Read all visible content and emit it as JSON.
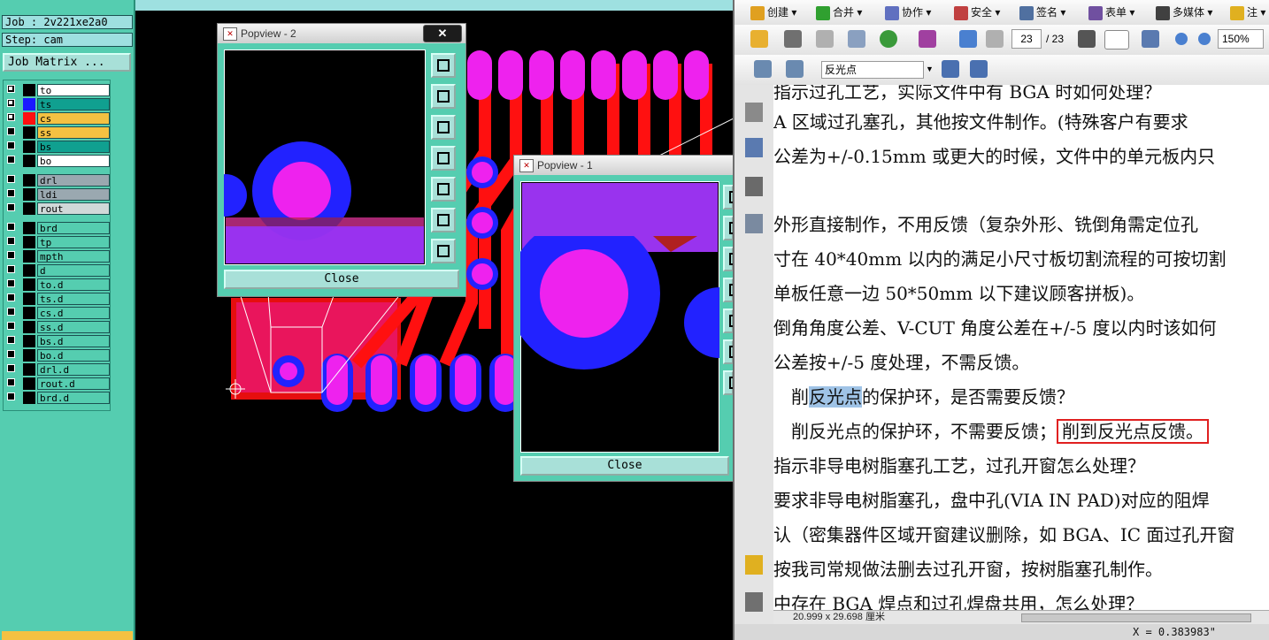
{
  "cam": {
    "job_line": "Job : 2v221xe2a0",
    "step_line": "Step: cam",
    "job_matrix_label": "Job Matrix ...",
    "layers": [
      {
        "name": "to",
        "checked": true,
        "swatch": "#000000",
        "bg": "#ffffff"
      },
      {
        "name": "ts",
        "checked": true,
        "swatch": "#1a1aff",
        "bg": "#10a090"
      },
      {
        "name": "cs",
        "checked": true,
        "swatch": "#ff1010",
        "bg": "#f4c142"
      },
      {
        "name": "ss",
        "checked": false,
        "swatch": "#000000",
        "bg": "#f4c142"
      },
      {
        "name": "bs",
        "checked": false,
        "swatch": "#000000",
        "bg": "#10a090"
      },
      {
        "name": "bo",
        "checked": false,
        "swatch": "#000000",
        "bg": "#ffffff"
      },
      {
        "name": "drl",
        "checked": false,
        "swatch": "#000000",
        "bg": "#9aa8b0"
      },
      {
        "name": "ldi",
        "checked": false,
        "swatch": "#000000",
        "bg": "#9aa8b0"
      },
      {
        "name": "rout",
        "checked": false,
        "swatch": "#000000",
        "bg": "#d0d8d8"
      },
      {
        "name": "brd",
        "checked": false,
        "swatch": "#000000",
        "bg": "#55cdb0"
      },
      {
        "name": "tp",
        "checked": false,
        "swatch": "#000000",
        "bg": "#55cdb0"
      },
      {
        "name": "mpth",
        "checked": false,
        "swatch": "#000000",
        "bg": "#55cdb0"
      },
      {
        "name": "d",
        "checked": false,
        "swatch": "#000000",
        "bg": "#55cdb0"
      },
      {
        "name": "to.d",
        "checked": false,
        "swatch": "#000000",
        "bg": "#55cdb0"
      },
      {
        "name": "ts.d",
        "checked": false,
        "swatch": "#000000",
        "bg": "#55cdb0"
      },
      {
        "name": "cs.d",
        "checked": false,
        "swatch": "#000000",
        "bg": "#55cdb0"
      },
      {
        "name": "ss.d",
        "checked": false,
        "swatch": "#000000",
        "bg": "#55cdb0"
      },
      {
        "name": "bs.d",
        "checked": false,
        "swatch": "#000000",
        "bg": "#55cdb0"
      },
      {
        "name": "bo.d",
        "checked": false,
        "swatch": "#000000",
        "bg": "#55cdb0"
      },
      {
        "name": "drl.d",
        "checked": false,
        "swatch": "#000000",
        "bg": "#55cdb0"
      },
      {
        "name": "rout.d",
        "checked": false,
        "swatch": "#000000",
        "bg": "#55cdb0"
      },
      {
        "name": "brd.d",
        "checked": false,
        "swatch": "#000000",
        "bg": "#55cdb0"
      }
    ],
    "colors": {
      "panel": "#55cdb0",
      "trace": "#ff0000",
      "pad": "#ee22ee",
      "mask": "#2222ff",
      "overlap": "#9933ee"
    }
  },
  "popview2": {
    "title": "Popview - 2",
    "close_x": "✕",
    "close_label": "Close"
  },
  "popview1": {
    "title": "Popview - 1",
    "close_label": "Close"
  },
  "pdf": {
    "toolbar1": [
      {
        "label": "创建",
        "color": "#e0a020"
      },
      {
        "label": "合并",
        "color": "#30a030"
      },
      {
        "label": "协作",
        "color": "#6070c0"
      },
      {
        "label": "安全",
        "color": "#c04040"
      },
      {
        "label": "签名",
        "color": "#5070a0"
      },
      {
        "label": "表单",
        "color": "#7050a0"
      },
      {
        "label": "多媒体",
        "color": "#404040"
      },
      {
        "label": "注",
        "color": "#e0b020"
      }
    ],
    "page_current": "23",
    "page_total": "/ 23",
    "zoom": "150%",
    "search_text": "反光点",
    "lines": [
      "指示过孔工艺，实际文件中有 BGA 时如何处理？",
      "A 区域过孔塞孔，其他按文件制作。(特殊客户有要求",
      "公差为+/-0.15mm 或更大的时候，文件中的单元板内只",
      "",
      "外形直接制作，不用反馈（复杂外形、铣倒角需定位孔",
      "寸在 40*40mm 以内的满足小尺寸板切割流程的可按切割",
      "单板任意一边 50*50mm 以下建议顾客拼板)。",
      "倒角角度公差、V-CUT 角度公差在+/-5 度以内时该如何",
      "公差按+/-5 度处理，不需反馈。",
      "削反光点的保护环，是否需要反馈？",
      "削反光点的保护环，不需要反馈；削到反光点反馈。",
      "指示非导电树脂塞孔工艺，过孔开窗怎么处理？",
      "要求非导电树脂塞孔，盘中孔(VIA IN PAD)对应的阻焊",
      "认（密集器件区域开窗建议删除，如 BGA、IC 面过孔开窗",
      "按我司常规做法删去过孔开窗，按树脂塞孔制作。",
      "中存在 BGA 焊点和过孔焊盘共用，怎么处理？"
    ],
    "line10_pre": "削",
    "line10_hl": "反光点",
    "line10_post": "的保护环，是否需要反馈？",
    "line11_pre": "削反光点的保护环，不需要反馈；",
    "line11_box": "削到反光点反馈。",
    "page_size": "20.999 x 29.698 厘米",
    "coord": "X = 0.383983\""
  }
}
